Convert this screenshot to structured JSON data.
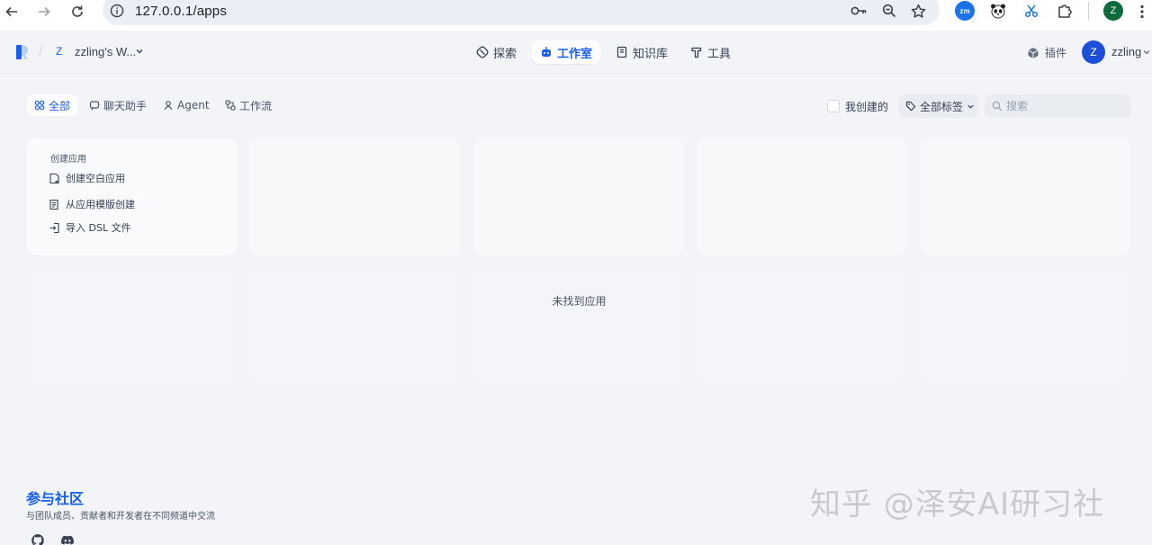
{
  "browser": {
    "url": "127.0.0.1/apps",
    "extensions": [
      "zm-extension-icon",
      "panda-extension-icon",
      "scissors-extension-icon",
      "puzzle-extensions-icon"
    ],
    "profile_initial": "Z"
  },
  "header": {
    "workspace_initial": "Z",
    "workspace_name": "zzling's W...",
    "nav": [
      {
        "label": "探索",
        "active": false
      },
      {
        "label": "工作室",
        "active": true
      },
      {
        "label": "知识库",
        "active": false
      },
      {
        "label": "工具",
        "active": false
      }
    ],
    "plugins_label": "插件",
    "user_initial": "Z",
    "username": "zzling"
  },
  "filters": {
    "tabs": [
      {
        "label": "全部",
        "active": true
      },
      {
        "label": "聊天助手",
        "active": false
      },
      {
        "label": "Agent",
        "active": false
      },
      {
        "label": "工作流",
        "active": false
      }
    ],
    "mine_label": "我创建的",
    "tags_label": "全部标签",
    "search_placeholder": "搜索"
  },
  "create_card": {
    "title": "创建应用",
    "items": [
      "创建空白应用",
      "从应用模版创建",
      "导入 DSL 文件"
    ]
  },
  "empty_state": "未找到应用",
  "footer": {
    "title": "参与社区",
    "subtitle": "与团队成员、贡献者和开发者在不同频道中交流"
  },
  "watermark": "知乎 @泽安AI研习社",
  "colors": {
    "accent": "#155eef",
    "background": "#f2f4f7"
  }
}
